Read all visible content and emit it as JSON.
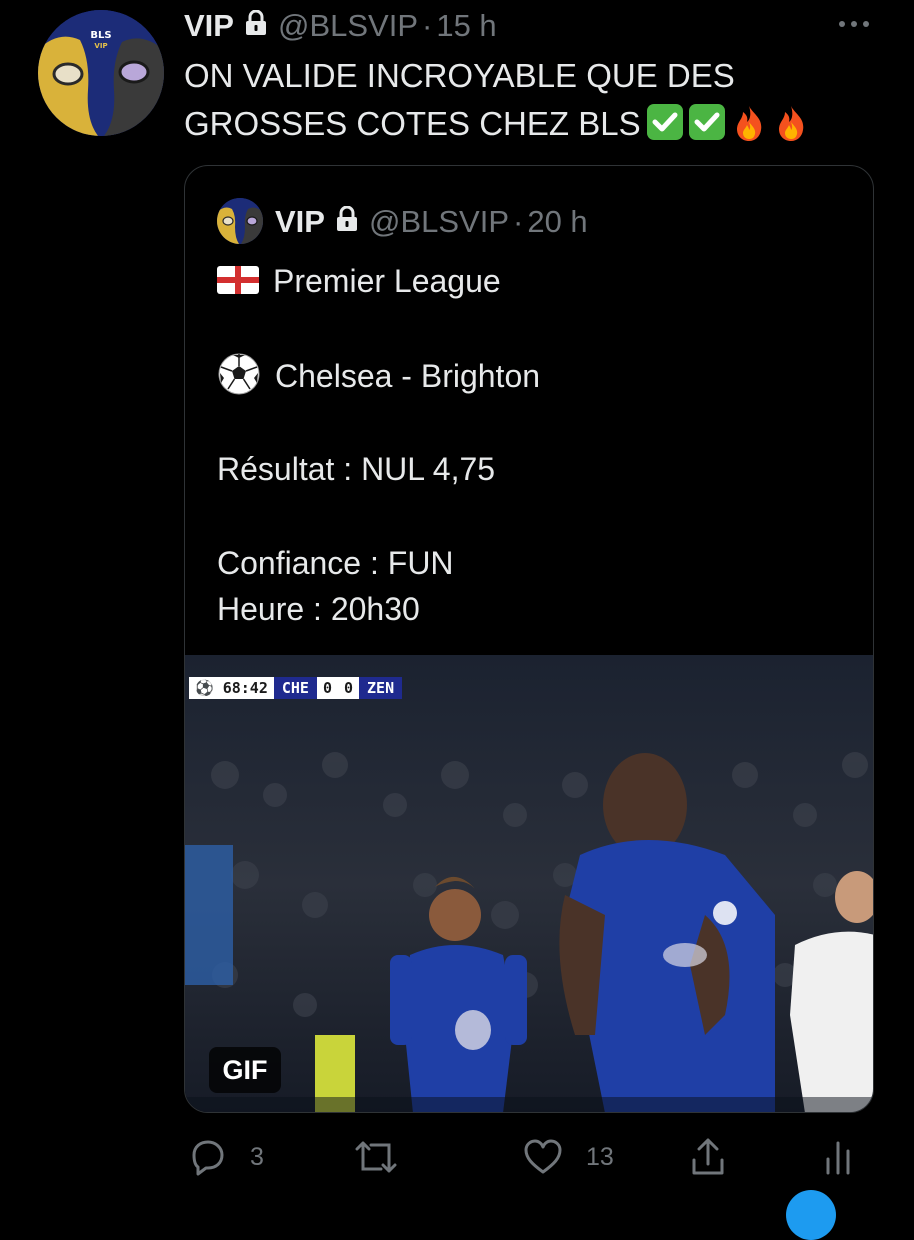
{
  "tweet": {
    "author_name": "VIP",
    "author_handle": "@BLSVIP",
    "separator": "·",
    "time": "15 h",
    "avatar_text": "BLS",
    "avatar_subtext": "VIP",
    "text_line1": "ON VALIDE INCROYABLE QUE DES",
    "text_line2": "GROSSES COTES CHEZ BLS",
    "emojis": [
      "check-mark-button",
      "check-mark-button",
      "fire",
      "fire"
    ]
  },
  "quoted_tweet": {
    "author_name": "VIP",
    "author_handle": "@BLSVIP",
    "separator": "·",
    "time": "20 h",
    "lines": {
      "league": "Premier League",
      "match": "Chelsea - Brighton",
      "result": "Résultat : NUL 4,75",
      "confidence": "Confiance : FUN",
      "time": "Heure : 20h30"
    },
    "league_flag_icon": "england-flag-icon",
    "match_icon": "soccer-ball-icon",
    "media": {
      "badge": "GIF",
      "scorebug": {
        "clock": "68:42",
        "home": "CHE",
        "home_score": "0",
        "away_score": "0",
        "away": "ZEN"
      }
    }
  },
  "actions": {
    "reply_count": "3",
    "retweet_count": "",
    "like_count": "13"
  },
  "colors": {
    "background": "#000000",
    "text_primary": "#e7e9ea",
    "text_secondary": "#71767b",
    "border": "#2f3336",
    "check_green": "#4bb543",
    "chelsea_blue": "#1f2a8f"
  }
}
